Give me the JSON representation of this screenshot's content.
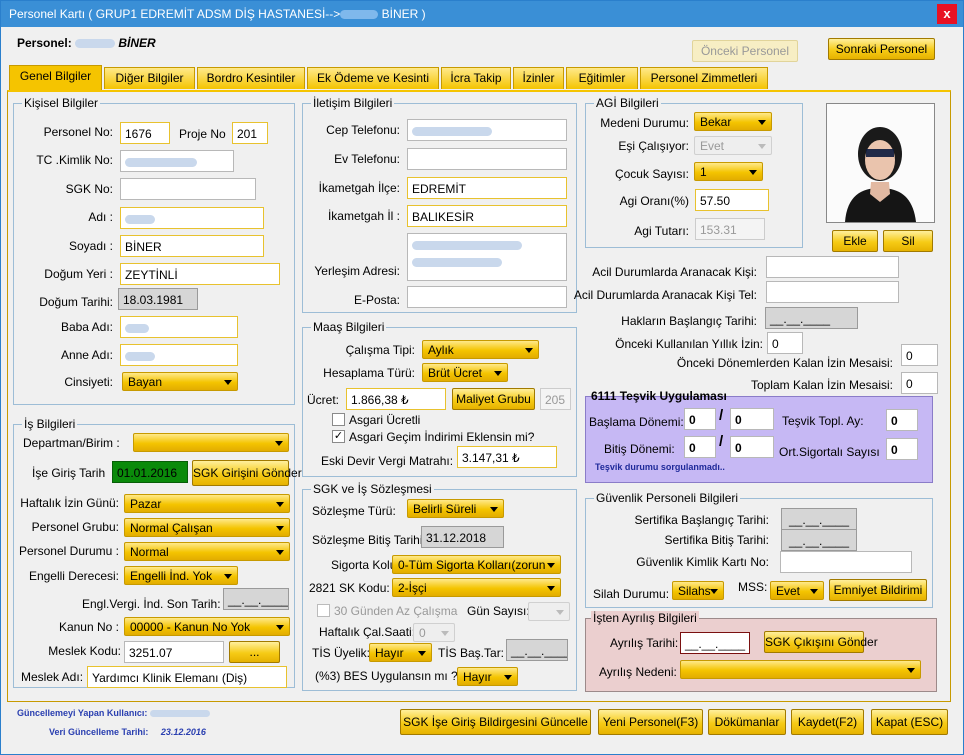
{
  "title": {
    "prefix": "Personel  Kartı ( GRUP1 EDREMİT ADSM DİŞ HASTANESİ-->",
    "suffix": " BİNER )"
  },
  "header": {
    "label": "Personel:",
    "name_suffix": "BİNER",
    "prev": "Önceki Personel",
    "next": "Sonraki Personel"
  },
  "tabs": [
    "Genel Bilgiler",
    "Diğer Bilgiler",
    "Bordro Kesintiler",
    "Ek Ödeme ve Kesinti",
    "İcra Takip",
    "İzinler",
    "Eğitimler",
    "Personel Zimmetleri"
  ],
  "kisisel": {
    "title": "Kişisel Bilgiler",
    "personel_no_l": "Personel No:",
    "personel_no": "1676",
    "proje_no_l": "Proje No",
    "proje_no": "201",
    "tc_l": "TC .Kimlik No:",
    "sgk_l": "SGK No:",
    "adi_l": "Adı :",
    "soyadi_l": "Soyadı :",
    "soyadi": "BİNER",
    "dyeri_l": "Doğum Yeri :",
    "dyeri": "ZEYTİNLİ",
    "dtarih_l": "Doğum Tarihi:",
    "dtarih": "18.03.1981",
    "baba_l": "Baba Adı:",
    "anne_l": "Anne Adı:",
    "cins_l": "Cinsiyeti:",
    "cins": "Bayan"
  },
  "is": {
    "title": "İş Bilgileri",
    "dept_l": "Departman/Birim :",
    "giris_l": "İşe Giriş Tarih",
    "giris": "01.01.2016",
    "sgk_btn": "SGK Girişini Gönder",
    "haftalik_l": "Haftalık İzin Günü:",
    "haftalik": "Pazar",
    "grup_l": "Personel Grubu:",
    "grup": "Normal Çalışan",
    "durum_l": "Personel Durumu :",
    "durum": "Normal",
    "engel_l": "Engelli Derecesi:",
    "engel": "Engelli İnd. Yok",
    "engl_l": "Engl.Vergi. İnd. Son Tarih:",
    "date_blank": "__.__.____",
    "kanun_l": "Kanun No :",
    "kanun": "00000 - Kanun No Yok",
    "meslek_kodu_l": "Meslek Kodu:",
    "meslek_kodu": "3251.07",
    "dots": "...",
    "meslek_adi_l": "Meslek Adı:",
    "meslek_adi": "Yardımcı Klinik Elemanı (Diş)"
  },
  "iletisim": {
    "title": "İletişim Bilgileri",
    "cep_l": "Cep Telefonu:",
    "ev_l": "Ev Telefonu:",
    "ilce_l": "İkametgah İlçe:",
    "ilce": "EDREMİT",
    "il_l": "İkametgah İl :",
    "il": "BALIKESİR",
    "adres_l": "Yerleşim Adresi:",
    "eposta_l": "E-Posta:"
  },
  "maas": {
    "title": "Maaş Bilgileri",
    "tip_l": "Çalışma Tipi:",
    "tip": "Aylık",
    "hesap_l": "Hesaplama Türü:",
    "hesap": "Brüt Ücret",
    "ucret_l": "Ücret:",
    "ucret": "1.866,38 ₺",
    "maliyet_btn": "Maliyet Grubu",
    "kod": "205",
    "asgari": "Asgari Ücretli",
    "agi_chk": "Asgari Geçim İndirimi Eklensin mi?",
    "devir_l": "Eski Devir Vergi Matrahı:",
    "devir": "3.147,31 ₺"
  },
  "sgk": {
    "title": "SGK ve İş Sözleşmesi",
    "soz_l": "Sözleşme Türü:",
    "soz": "Belirli Süreli",
    "bitis_l": "Sözleşme Bitiş Tarihi:",
    "bitis": "31.12.2018",
    "sigorta_l": "Sigorta Kolu:",
    "sigorta": "0-Tüm Sigorta Kolları(zorun",
    "sk_l": "2821 SK Kodu:",
    "sk": "2-İşçi",
    "otuz": "30 Günden Az Çalışma",
    "gun_l": "Gün Sayısı:",
    "haft_l": "Haftalık Çal.Saati:",
    "haft": "0",
    "tis_l": "TİS Üyelik:",
    "tis": "Hayır",
    "tisbas_l": "TİS Baş.Tar:",
    "bes_l": "(%3) BES  Uygulansın mı ?",
    "bes": "Hayır"
  },
  "agi": {
    "title": "AGİ Bilgileri",
    "medeni_l": "Medeni Durumu:",
    "medeni": "Bekar",
    "esi_l": "Eşi Çalışıyor:",
    "esi": "Evet",
    "cocuk_l": "Çocuk Sayısı:",
    "cocuk": "1",
    "oran_l": "Agi Oranı(%)",
    "oran": "57.50",
    "tutar_l": "Agi Tutarı:",
    "tutar": "153.31"
  },
  "photo": {
    "add": "Ekle",
    "del": "Sil"
  },
  "acil": {
    "kisi_l": "Acil Durumlarda Aranacak Kişi:",
    "tel_l": "Acil Durumlarda Aranacak Kişi Tel:",
    "hak_l": "Hakların Başlangıç Tarihi:",
    "onceki_l": "Önceki Kullanılan Yıllık İzin:",
    "onceki": "0",
    "kalan_l": "Önceki Dönemlerden Kalan İzin Mesaisi:",
    "kalan": "0",
    "toplam_l": "Toplam Kalan İzin Mesaisi:",
    "toplam": "0"
  },
  "tesvik": {
    "title": "6111 Teşvik Uygulaması",
    "bas_l": "Başlama Dönemi:",
    "bitis_l": "Bitiş Dönemi:",
    "zero": "0",
    "slash": "/",
    "topl_l": "Teşvik Topl. Ay:",
    "ort_l": "Ort.Sigortalı Sayısı",
    "sorgu": "Teşvik durumu sorgulanmadı.."
  },
  "guvenlik": {
    "title": "Güvenlik Personeli Bilgileri",
    "sbas_l": "Sertifika Başlangıç Tarihi:",
    "sbit_l": "Sertifika Bitiş Tarihi:",
    "kimlik_l": "Güvenlik Kimlik Kartı No:",
    "silah_l": "Silah Durumu:",
    "silah": "Silahs",
    "mss_l": "MSS:",
    "mss": "Evet",
    "emn_btn": "Emniyet Bildirimi"
  },
  "ayrilis": {
    "title": "İşten Ayrılış Bilgileri",
    "tarih_l": "Ayrılış Tarihi:",
    "btn": "SGK Çıkışını Gönder",
    "neden_l": "Ayrılış Nedeni:"
  },
  "footer": {
    "guncel_l": "Güncellemeyi Yapan  Kullanıcı:",
    "tarih_l": "Veri Güncelleme Tarihi:",
    "tarih": "23.12.2016",
    "b1": "SGK İşe Giriş Bildirgesini Güncelle",
    "b2": "Yeni Personel(F3)",
    "b3": "Dökümanlar",
    "b4": "Kaydet(F2)",
    "b5": "Kapat (ESC)"
  },
  "close": "x"
}
